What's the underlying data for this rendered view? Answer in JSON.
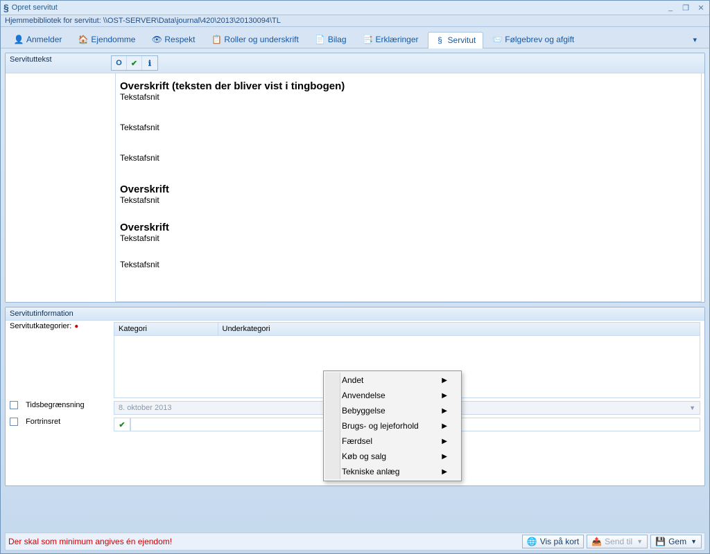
{
  "window": {
    "title": "Opret servitut"
  },
  "pathbar": "Hjemmebibliotek for servitut: \\\\OST-SERVER\\Data\\journal\\420\\2013\\20130094\\TL",
  "tabs": [
    {
      "label": "Anmelder"
    },
    {
      "label": "Ejendomme"
    },
    {
      "label": "Respekt"
    },
    {
      "label": "Roller og underskrift"
    },
    {
      "label": "Bilag"
    },
    {
      "label": "Erklæringer"
    },
    {
      "label": "Servitut"
    },
    {
      "label": "Følgebrev og afgift"
    }
  ],
  "servituttekst": {
    "label": "Servituttekst",
    "heading1": "Overskrift (teksten der bliver vist i tingbogen)",
    "p1": "Tekstafsnit",
    "p2": "Tekstafsnit",
    "p3": "Tekstafsnit",
    "heading2": "Overskrift",
    "p4": "Tekstafsnit",
    "heading3": "Overskrift",
    "p5": "Tekstafsnit",
    "p6": "Tekstafsnit"
  },
  "servitutinfo": {
    "title": "Servitutinformation",
    "kategorier_label": "Servitutkategorier:",
    "cols": {
      "kategori": "Kategori",
      "underkategori": "Underkategori"
    },
    "tids_label": "Tidsbegrænsning",
    "tids_value": "8. oktober 2013",
    "fortrin_label": "Fortrinsret"
  },
  "context_menu": [
    "Andet",
    "Anvendelse",
    "Bebyggelse",
    "Brugs- og lejeforhold",
    "Færdsel",
    "Køb og salg",
    "Tekniske anlæg"
  ],
  "status": {
    "error": "Der skal som minimum angives én ejendom!",
    "vis_kort": "Vis på kort",
    "send_til": "Send til",
    "gem": "Gem"
  }
}
